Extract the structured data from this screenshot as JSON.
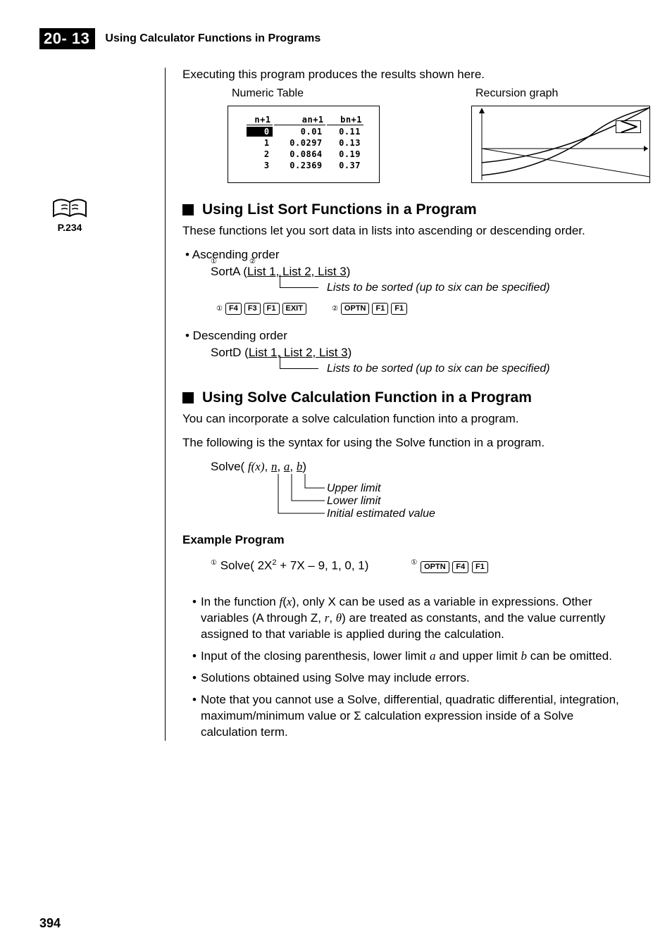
{
  "header": {
    "section_number": "20- 13",
    "section_title": "Using Calculator Functions in Programs"
  },
  "sidebar": {
    "page_ref": "P.234"
  },
  "intro": "Executing this program produces the results shown here.",
  "fig_labels": {
    "numeric": "Numeric Table",
    "recursion": "Recursion graph"
  },
  "numeric_table": {
    "headers": [
      "n+1",
      "an+1",
      "bn+1"
    ],
    "rows": [
      [
        "0",
        "0.01",
        "0.11"
      ],
      [
        "1",
        "0.0297",
        "0.13"
      ],
      [
        "2",
        "0.0864",
        "0.19"
      ],
      [
        "3",
        "0.2369",
        "0.37"
      ]
    ]
  },
  "h2a": "Using List Sort Functions in a Program",
  "list_sort_intro": "These functions let you sort data in lists into ascending or descending order.",
  "ascending_bullet": "• Ascending order",
  "sortA_code_pre": "SortA (",
  "sort_lists": "List 1, List 2, List 3",
  "sort_close": ")",
  "sort_annot": "Lists to be sorted (up to six can be specified)",
  "keys1": [
    "F4",
    "F3",
    "F1",
    "EXIT"
  ],
  "keys2": [
    "OPTN",
    "F1",
    "F1"
  ],
  "descending_bullet": "• Descending order",
  "sortD_code_pre": "SortD (",
  "h2b": "Using Solve Calculation Function in a Program",
  "solve_intro1": "You can incorporate a solve calculation function into a program.",
  "solve_intro2": "The following is the syntax for using the Solve function in a program.",
  "solve_syntax_pre": "Solve( ",
  "solve_args_fx": "f(x)",
  "solve_args_rest": ", n, a, b)",
  "solve_labels": {
    "upper": "Upper limit",
    "lower": "Lower limit",
    "initial": "Initial estimated value"
  },
  "example_h": "Example Program",
  "example_code": "Solve( 2X² + 7X – 9, 1, 0, 1)",
  "example_keys": [
    "OPTN",
    "F4",
    "F1"
  ],
  "notes": [
    "In the function f(x), only X can be used as a variable in expressions. Other variables (A through Z, r, θ) are treated as constants, and the value currently assigned to that variable is applied during the calculation.",
    "Input of the closing parenthesis, lower limit a and upper limit b can be omitted.",
    "Solutions obtained using Solve may include errors.",
    "Note that you cannot use a Solve, differential, quadratic differential, integration, maximum/minimum value or Σ calculation expression inside of a Solve calculation term."
  ],
  "page_number": "394"
}
